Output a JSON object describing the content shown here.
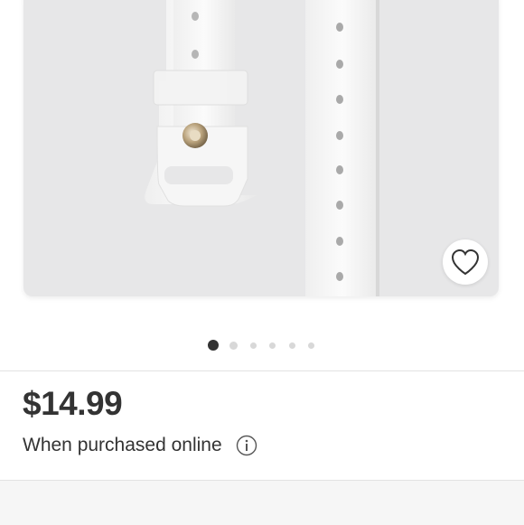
{
  "product": {
    "image_alt": "White silicone watch band",
    "carousel_count": 6,
    "carousel_active_index": 0
  },
  "pricing": {
    "price": "$14.99",
    "note": "When purchased online"
  },
  "icons": {
    "favorite": "heart-outline-icon",
    "info": "info-circle-icon"
  },
  "colors": {
    "text": "#333333",
    "dot_active": "#333333",
    "dot_inactive": "#d8d8d8",
    "photo_bg": "#e7e7e8"
  }
}
